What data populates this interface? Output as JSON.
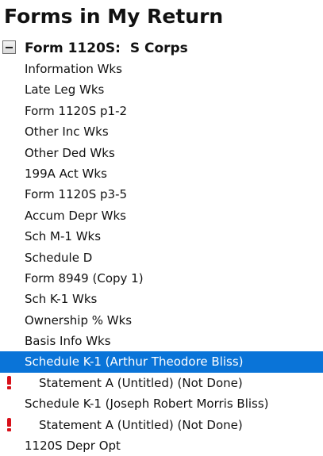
{
  "panel": {
    "title": "Forms in My Return"
  },
  "group": {
    "label": "Form 1120S:  S Corps",
    "expanded": true
  },
  "items": [
    {
      "label": "Information Wks"
    },
    {
      "label": "Late Leg Wks"
    },
    {
      "label": "Form 1120S p1-2"
    },
    {
      "label": "Other Inc Wks"
    },
    {
      "label": "Other Ded Wks"
    },
    {
      "label": "199A Act Wks"
    },
    {
      "label": "Form 1120S p3-5"
    },
    {
      "label": "Accum Depr Wks"
    },
    {
      "label": "Sch M-1 Wks"
    },
    {
      "label": "Schedule D"
    },
    {
      "label": "Form 8949 (Copy 1)"
    },
    {
      "label": "Sch K-1 Wks"
    },
    {
      "label": "Ownership % Wks"
    },
    {
      "label": "Basis Info Wks"
    },
    {
      "label": "Schedule K-1 (Arthur Theodore Bliss)",
      "selected": true
    },
    {
      "label": "Statement A (Untitled) (Not Done)",
      "child": true,
      "alert": true
    },
    {
      "label": "Schedule K-1 (Joseph Robert Morris Bliss)"
    },
    {
      "label": "Statement A (Untitled) (Not Done)",
      "child": true,
      "alert": true
    },
    {
      "label": "1120S Depr Opt"
    }
  ],
  "colors": {
    "selection": "#0a74d8",
    "alert": "#d8101a"
  },
  "icons": {
    "collapse": "collapse-minus-icon",
    "alert": "error-exclamation-icon"
  }
}
